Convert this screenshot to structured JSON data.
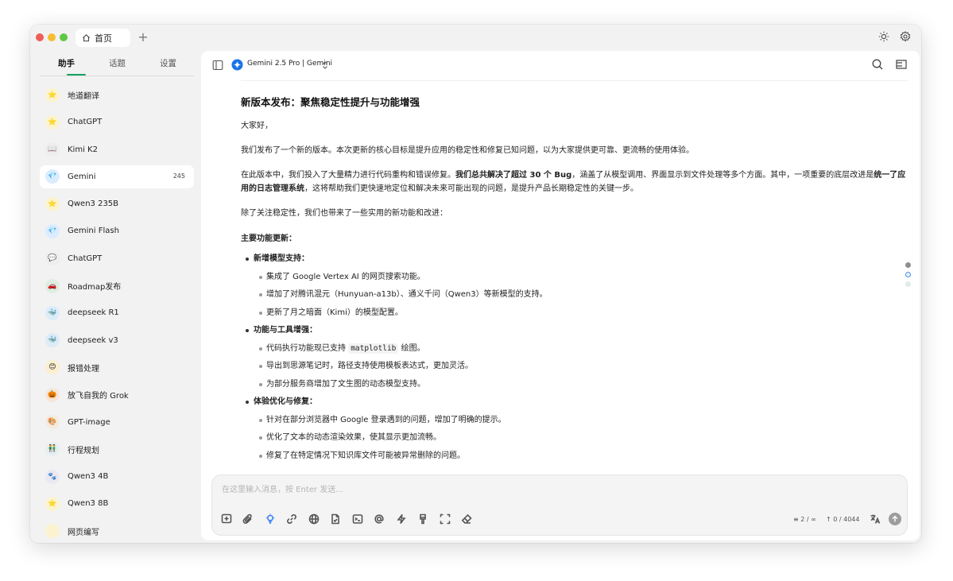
{
  "titlebar": {
    "home_tab_label": "首页",
    "new_tab_glyph": "+"
  },
  "sidebar": {
    "tabs": [
      {
        "label": "助手",
        "active": true
      },
      {
        "label": "话题",
        "active": false
      },
      {
        "label": "设置",
        "active": false
      }
    ],
    "items": [
      {
        "label": "地道翻译",
        "avatar": "⭐",
        "avatar_bg": "#fbf3cf"
      },
      {
        "label": "ChatGPT",
        "avatar": "⭐",
        "avatar_bg": "#fbf3cf"
      },
      {
        "label": "Kimi K2",
        "avatar": "📖",
        "avatar_bg": "#eeeeee"
      },
      {
        "label": "Gemini",
        "avatar": "💎",
        "avatar_bg": "#dcecff",
        "count": "245",
        "active": true
      },
      {
        "label": "Qwen3 235B",
        "avatar": "⭐",
        "avatar_bg": "#fbf3cf"
      },
      {
        "label": "Gemini Flash",
        "avatar": "💎",
        "avatar_bg": "#dcecff"
      },
      {
        "label": "ChatGPT",
        "avatar": "💬",
        "avatar_bg": "#eeeeee"
      },
      {
        "label": "Roadmap发布",
        "avatar": "🚗",
        "avatar_bg": "#dfeee0"
      },
      {
        "label": "deepseek R1",
        "avatar": "🐳",
        "avatar_bg": "#dcecf8"
      },
      {
        "label": "deepseek v3",
        "avatar": "🐳",
        "avatar_bg": "#dcecf8"
      },
      {
        "label": "报错处理",
        "avatar": "😊",
        "avatar_bg": "#fbefcf"
      },
      {
        "label": "放飞自我的 Grok",
        "avatar": "🎃",
        "avatar_bg": "#f6e5d8"
      },
      {
        "label": "GPT-image",
        "avatar": "🎨",
        "avatar_bg": "#f3ebdf"
      },
      {
        "label": "行程规划",
        "avatar": "👬",
        "avatar_bg": "#e5eef0"
      },
      {
        "label": "Qwen3 4B",
        "avatar": "🐾",
        "avatar_bg": "#ece8f1"
      },
      {
        "label": "Qwen3 8B",
        "avatar": "⭐",
        "avatar_bg": "#fbf3cf"
      },
      {
        "label": "网页编写",
        "avatar": "",
        "avatar_bg": "#fbf3cf"
      }
    ]
  },
  "header": {
    "model_name": "Gemini 2.5 Pro | Gemini"
  },
  "message": {
    "title": "新版本发布：聚焦稳定性提升与功能增强",
    "greeting": "大家好，",
    "p1": "我们发布了一个新的版本。本次更新的核心目标是提升应用的稳定性和修复已知问题，以为大家提供更可靠、更流畅的使用体验。",
    "p2_a": "在此版本中，我们投入了大量精力进行代码重构和错误修复。",
    "p2_b": "我们总共解决了超过 30 个 Bug",
    "p2_c": "，涵盖了从模型调用、界面显示到文件处理等多个方面。其中，一项重要的底层改进是",
    "p2_d": "统一了应用的日志管理系统",
    "p2_e": "，这将帮助我们更快速地定位和解决未来可能出现的问题，是提升产品长期稳定性的关键一步。",
    "p3": "除了关注稳定性，我们也带来了一些实用的新功能和改进：",
    "section_title": "主要功能更新：",
    "groups": [
      {
        "title": "新增模型支持：",
        "items": [
          "集成了 Google Vertex AI 的网页搜索功能。",
          "增加了对腾讯混元（Hunyuan-a13b）、通义千问（Qwen3）等新模型的支持。",
          "更新了月之暗面（Kimi）的模型配置。"
        ]
      },
      {
        "title": "功能与工具增强：",
        "items": [
          "代码执行功能现已支持 ",
          "导出到思源笔记时，路径支持使用模板表达式，更加灵活。",
          "为部分服务商增加了文生图的动态模型支持。"
        ],
        "code_word": "matplotlib",
        "code_suffix": " 绘图。"
      },
      {
        "title": "体验优化与修复：",
        "items": [
          "针对在部分浏览器中 Google 登录遇到的问题，增加了明确的提示。",
          "优化了文本的动态渲染效果，使其显示更加流畅。",
          "修复了在特定情况下知识库文件可能被异常删除的问题。"
        ]
      }
    ]
  },
  "composer": {
    "placeholder": "在这里输入消息，按 Enter 发送...",
    "context_count": "2 / ∞",
    "token_count": "0 / 4044"
  },
  "colors": {
    "accent_green": "#19a15f",
    "model_icon_blue": "#1a73e8"
  }
}
